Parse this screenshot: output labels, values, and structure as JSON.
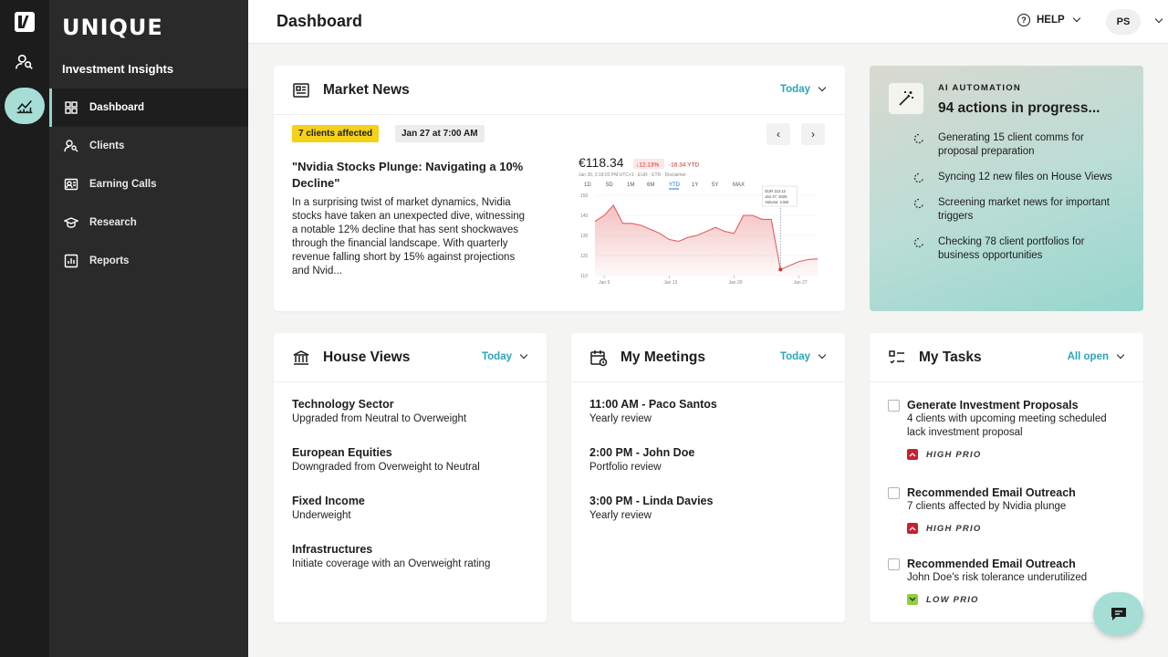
{
  "app": {
    "brand": "UNIQUE",
    "section": "Investment Insights",
    "page_title": "Dashboard"
  },
  "colors": {
    "accent": "#2aa5b8",
    "rail_active": "#a6ded6",
    "badge_yellow": "#f5d11a",
    "high_prio": "#c8202f",
    "low_prio": "#8fcf3f"
  },
  "rail": {
    "items": [
      {
        "icon": "brand-logo-icon"
      },
      {
        "icon": "user-search-icon"
      },
      {
        "icon": "chart-icon",
        "active": true
      }
    ]
  },
  "sidebar": {
    "items": [
      {
        "label": "Dashboard",
        "icon": "grid-icon",
        "active": true
      },
      {
        "label": "Clients",
        "icon": "clients-icon"
      },
      {
        "label": "Earning Calls",
        "icon": "earning-calls-icon"
      },
      {
        "label": "Research",
        "icon": "graduation-cap-icon"
      },
      {
        "label": "Reports",
        "icon": "report-icon"
      }
    ]
  },
  "header": {
    "help_label": "HELP",
    "avatar": "PS"
  },
  "market_news": {
    "title": "Market News",
    "filter": "Today",
    "badge_affected": "7 clients affected",
    "badge_date": "Jan 27 at 7:00 AM",
    "headline": "\"Nvidia Stocks Plunge: Navigating a 10% Decline\"",
    "body": "In a surprising twist of market dynamics, Nvidia stocks have taken an unexpected dive, witnessing a notable 12% decline that has sent shockwaves through the financial landscape. With quarterly revenue falling short by 15% against projections and Nvid..."
  },
  "chart_data": {
    "type": "area",
    "price": "€118.34",
    "change_pct": "↓12.13%",
    "change_ytd": "-16.34 YTD",
    "subtitle": "Jan 30, 3:18:03 PM UTC+1 · EUR · ETR · Disclaimer",
    "ranges": [
      "1D",
      "5D",
      "1M",
      "6M",
      "YTD",
      "1Y",
      "5Y",
      "MAX"
    ],
    "active_range": "YTD",
    "y_ticks": [
      150,
      140,
      130,
      120,
      110
    ],
    "x_ticks": [
      "Jan 6",
      "Jan 13",
      "Jan 20",
      "Jan 27"
    ],
    "ylim": [
      110,
      150
    ],
    "tooltip": [
      "EUR 113.12",
      "Jan 27, 2025",
      "Volume: 2.5M"
    ],
    "x": [
      0,
      1,
      2,
      3,
      4,
      5,
      6,
      7,
      8,
      9,
      10,
      11,
      12,
      13,
      14,
      15,
      16,
      17,
      18,
      19,
      20,
      21,
      22,
      23,
      24
    ],
    "values": [
      137,
      140,
      145,
      136,
      136,
      135,
      133,
      131,
      128,
      127,
      129,
      130,
      132,
      134,
      132,
      131,
      140,
      140,
      138,
      138,
      113,
      115,
      117,
      118,
      118.34
    ]
  },
  "ai": {
    "label": "AI AUTOMATION",
    "title": "94 actions in progress...",
    "items": [
      "Generating 15 client comms for proposal preparation",
      "Syncing 12 new files on House Views",
      "Screening market news for important triggers",
      "Checking 78 client portfolios for business opportunities"
    ]
  },
  "house_views": {
    "title": "House Views",
    "filter": "Today",
    "items": [
      {
        "t": "Technology Sector",
        "s": "Upgraded from Neutral to Overweight"
      },
      {
        "t": "European Equities",
        "s": "Downgraded from Overweight to Neutral"
      },
      {
        "t": "Fixed Income",
        "s": "Underweight"
      },
      {
        "t": "Infrastructures",
        "s": "Initiate coverage with an Overweight rating"
      }
    ]
  },
  "meetings": {
    "title": "My Meetings",
    "filter": "Today",
    "items": [
      {
        "t": "11:00 AM - Paco Santos",
        "s": "Yearly review"
      },
      {
        "t": "2:00 PM - John Doe",
        "s": "Portfolio review"
      },
      {
        "t": "3:00 PM - Linda Davies",
        "s": "Yearly review"
      }
    ]
  },
  "tasks": {
    "title": "My Tasks",
    "filter": "All open",
    "items": [
      {
        "t": "Generate Investment Proposals",
        "s": "4 clients with upcoming meeting scheduled lack investment proposal",
        "prio": "HIGH PRIO"
      },
      {
        "t": "Recommended Email Outreach",
        "s": "7 clients affected by Nvidia plunge",
        "prio": "HIGH PRIO"
      },
      {
        "t": "Recommended Email Outreach",
        "s": "John Doe's risk tolerance underutilized",
        "prio": "LOW PRIO"
      }
    ]
  }
}
